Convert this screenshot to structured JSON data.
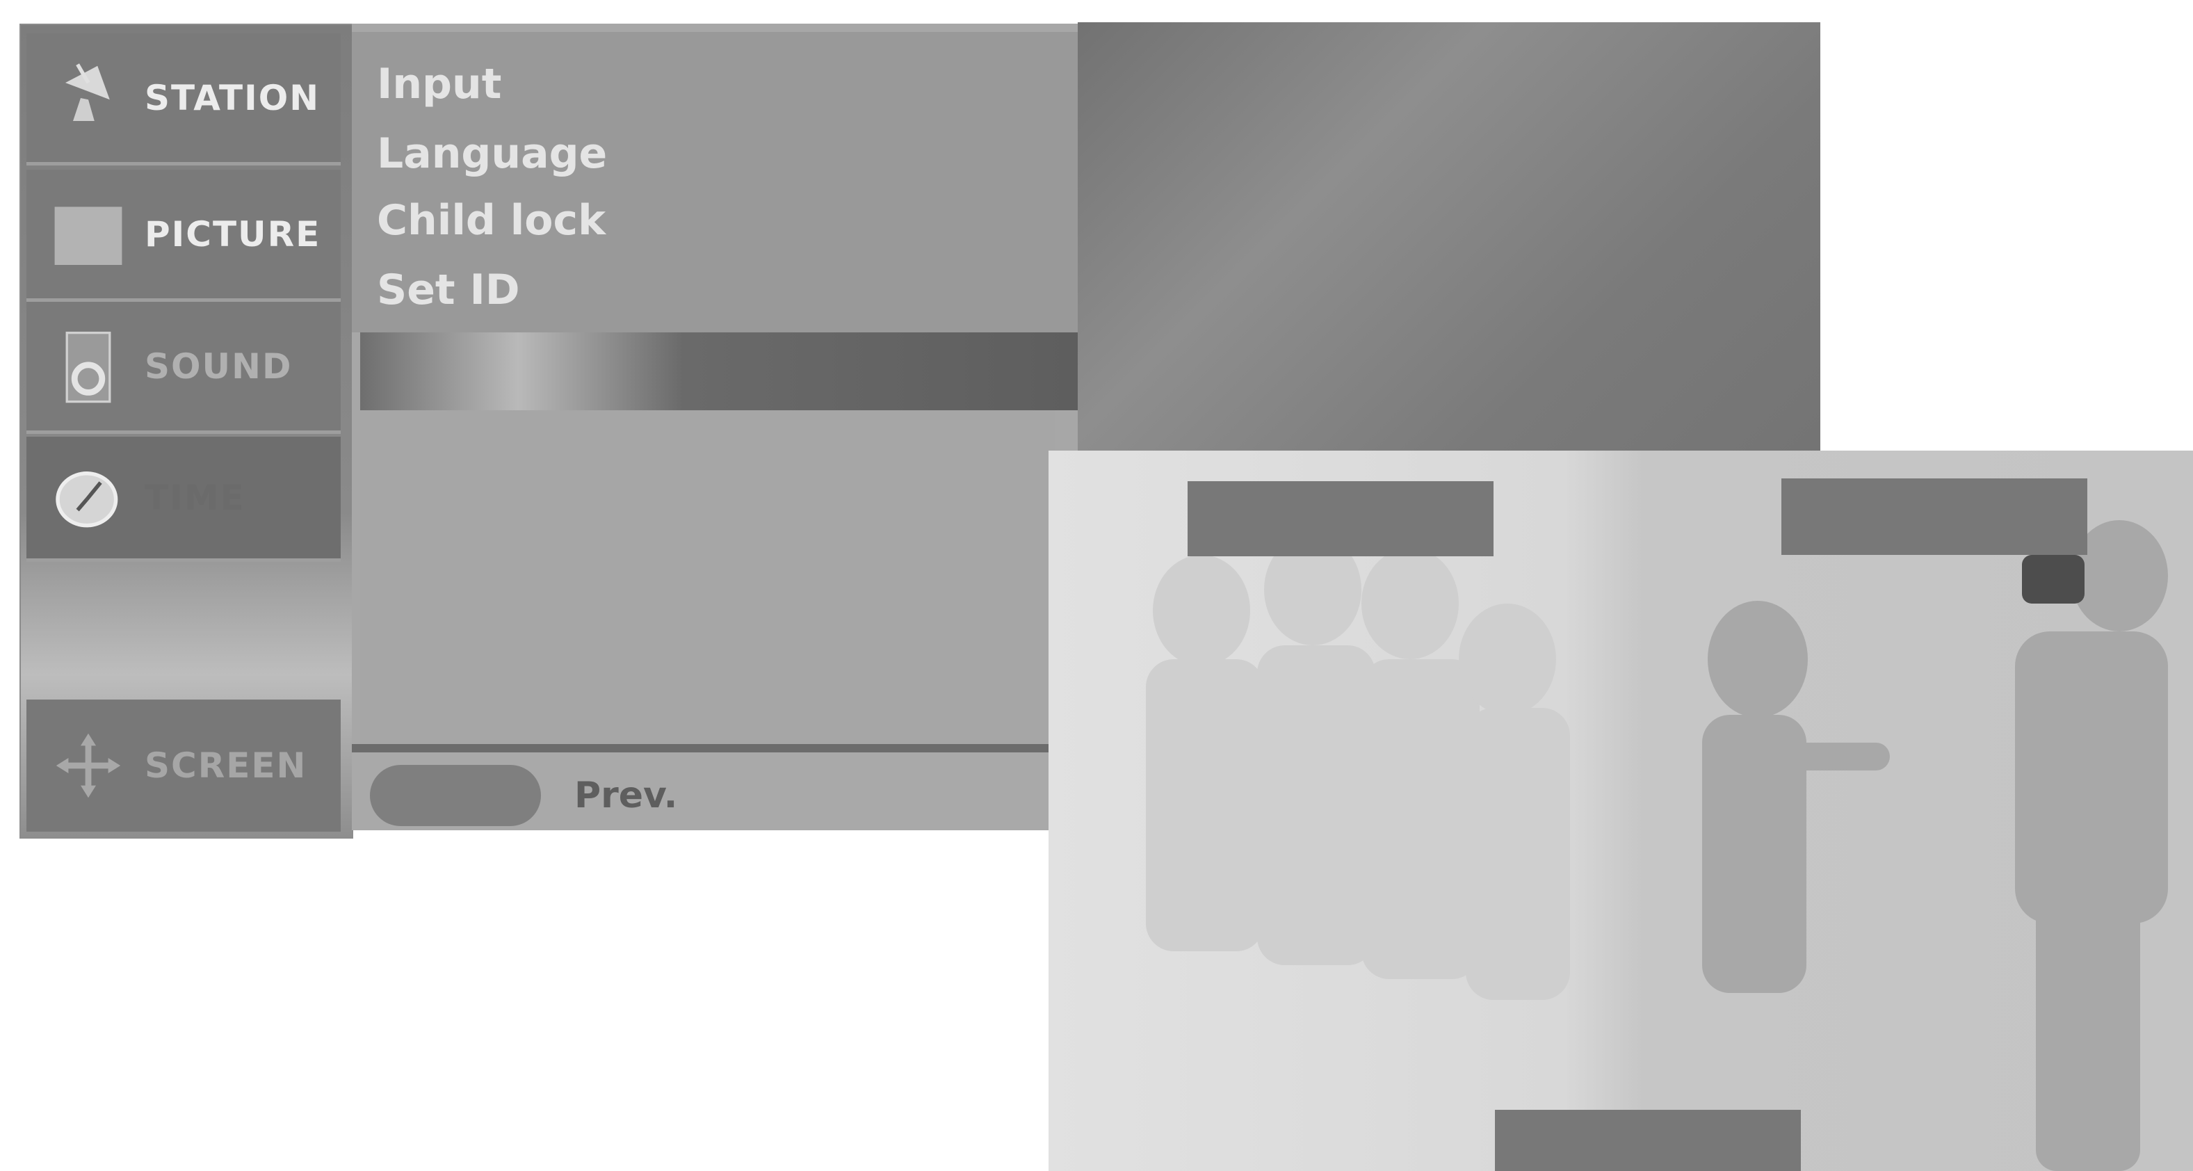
{
  "categories": [
    {
      "key": "station",
      "label": "STATION",
      "icon": "satellite-dish-icon"
    },
    {
      "key": "picture",
      "label": "PICTURE",
      "icon": "picture-square-icon"
    },
    {
      "key": "sound",
      "label": "SOUND",
      "icon": "speaker-icon"
    },
    {
      "key": "time",
      "label": "TIME",
      "icon": "clock-icon"
    },
    {
      "key": "screen",
      "label": "SCREEN",
      "icon": "move-arrows-icon"
    }
  ],
  "submenu": {
    "items": [
      "Input",
      "Language",
      "Child lock",
      "Set ID"
    ]
  },
  "footer": {
    "prev_label": "Prev."
  }
}
